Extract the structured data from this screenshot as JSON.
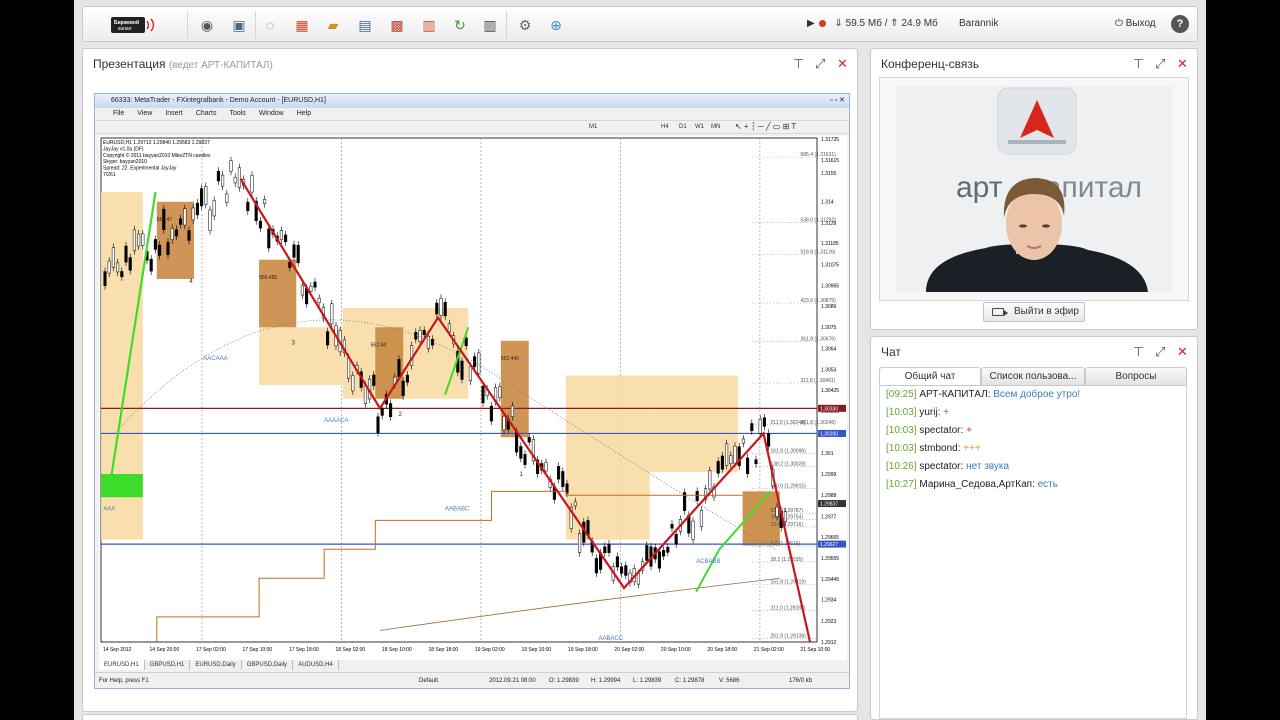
{
  "toolbar": {
    "icons": [
      "webcam-icon",
      "presentation-icon",
      "chat-bubble-icon",
      "cubes-icon",
      "folder-icon",
      "clipboard-icon",
      "blocks-icon",
      "notes-icon",
      "refresh-arrow-icon",
      "layout-icon",
      "gear-icon",
      "add-user-icon"
    ],
    "download": "⇓ 59.5 Мб",
    "upload": "⇑ 24.9 Мб",
    "username": "Barannik",
    "logout": "Выход",
    "help": "?"
  },
  "presentation": {
    "title": "Презентация",
    "subtitle": "(ведет АРТ-КАПИТАЛ)"
  },
  "metatrader": {
    "window_title": "66333: MetaTrader - FXintegralbank - Demo Account - [EURUSD,H1]",
    "menu": [
      "File",
      "View",
      "Insert",
      "Charts",
      "Tools",
      "Window",
      "Help"
    ],
    "timeframes": [
      "M1",
      "H4",
      "D1",
      "W1",
      "MN"
    ],
    "info_lines": [
      "EURUSD,H1 1.29713 1.29840 1.29583 1.29837",
      "JayJay v1.0a (DF)",
      "Copyright © 2011 bayyan2010 MikeZTN candles",
      "Skype: bayyan2010",
      "Spread: 22. Experimental JayJay",
      "7/261"
    ],
    "symbol_tabs": [
      "EURUSD,H1",
      "GBPUSD,H1",
      "EURUSD,Daily",
      "GBPUSD,Daily",
      "AUDUSD,H4"
    ],
    "status": {
      "help": "For Help, press F1",
      "profile": "Default",
      "datetime": "2012.09.21 08:00",
      "open": "O: 1.29839",
      "high": "H: 1.29994",
      "low": "L: 1.29839",
      "close": "C: 1.29878",
      "volume": "V: 5686",
      "traffic": "176/0 kb"
    }
  },
  "chart_data": {
    "type": "line",
    "symbol": "EURUSD,H1",
    "ylim": [
      1.2912,
      1.3173
    ],
    "y_ticks": [
      1.31725,
      1.31615,
      1.3155,
      1.314,
      1.3129,
      1.31185,
      1.31075,
      1.30965,
      1.3086,
      1.3075,
      1.3064,
      1.3053,
      1.30425,
      1.30315,
      1.30205,
      1.301,
      1.2999,
      1.2988,
      1.2977,
      1.29665,
      1.29555,
      1.29445,
      1.2934,
      1.2923,
      1.2912
    ],
    "x_ticks": [
      "14 Sep 2012",
      "14 Sep 20:00",
      "17 Sep 02:00",
      "17 Sep 10:00",
      "17 Sep 18:00",
      "18 Sep 02:00",
      "18 Sep 10:00",
      "18 Sep 18:00",
      "19 Sep 02:00",
      "19 Sep 10:00",
      "19 Sep 18:00",
      "20 Sep 02:00",
      "20 Sep 10:00",
      "20 Sep 18:00",
      "21 Sep 02:00",
      "21 Sep 10:00"
    ],
    "price_labels": [
      "1.30330",
      "1.30200",
      "1.29837",
      "1.29627"
    ],
    "fib_labels": [
      "685.4 (1.31631)",
      "538.0 (1.31292)",
      "518.8 (1.31126)",
      "423.6 (1.30875)",
      "361.8 (1.30676)",
      "311.8 (1.30461)",
      "261.8 (1.30245)",
      "211.0 (1.30244)",
      "161.8 (1.30096)",
      "138.2 (1.30028)",
      "100.0 (1.29915)",
      "50.0 (1.29787)",
      "38.2 (1.29754)",
      "23.6 (1.29716)",
      "0.0 (1.29616)",
      "38.2 (1.29535)",
      "161.8 (1.29419)",
      "211.0 (1.29283)",
      "261.8 (1.29138)"
    ],
    "pattern_labels": [
      "4",
      "3",
      "2",
      "1",
      "AACAAA",
      "AAAACA",
      "AABABC",
      "AAA",
      "ACBABB",
      "AABACC"
    ],
    "box_labels": [
      "562.47",
      "550.450",
      "562.44",
      "552.440"
    ],
    "red_zigzag": [
      {
        "x": "17 Sep 10:00",
        "y": 1.3152
      },
      {
        "x": "18 Sep 10:00",
        "y": 1.3033
      },
      {
        "x": "18 Sep 20:00",
        "y": 1.308
      },
      {
        "x": "20 Sep 04:00",
        "y": 1.294
      },
      {
        "x": "21 Sep 04:00",
        "y": 1.302
      },
      {
        "x": "21 Sep 12:00",
        "y": 1.2912
      }
    ],
    "green_zigzag": [
      {
        "x": "14 Sep 2012",
        "y": 1.299
      },
      {
        "x": "14 Sep 20:00",
        "y": 1.3145
      }
    ]
  },
  "conference": {
    "title": "Конференц-связь",
    "logo_text_left": "арт",
    "logo_text_right": "капитал",
    "go_live_button": "Выйти в эфир"
  },
  "chat": {
    "title": "Чат",
    "tabs": [
      "Общий чат",
      "Список пользова...",
      "Вопросы"
    ],
    "messages": [
      {
        "time": "[09:25]",
        "name": "АРТ-КАПИТАЛ:",
        "text": "Всем доброе утро!"
      },
      {
        "time": "[10:03]",
        "name": "yurij:",
        "text": "+"
      },
      {
        "time": "[10:03]",
        "name": "spectator:",
        "text": "+"
      },
      {
        "time": "[10:03]",
        "name": "stmbond:",
        "text": "+++"
      },
      {
        "time": "[10:26]",
        "name": "spectator:",
        "text": "нет звука"
      },
      {
        "time": "[10:27]",
        "name": "Марина_Седова,АртКап:",
        "text": "есть"
      }
    ]
  }
}
